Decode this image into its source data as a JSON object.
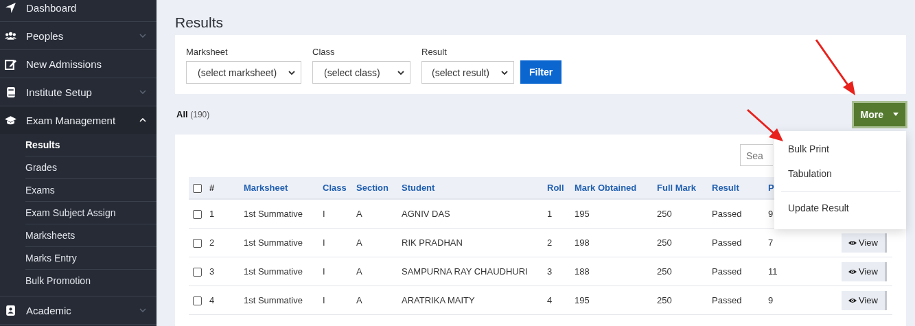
{
  "sidebar": {
    "items": [
      {
        "label": "Dashboard",
        "expandable": false
      },
      {
        "label": "Peoples",
        "expandable": true,
        "expanded": false
      },
      {
        "label": "New Admissions",
        "expandable": false
      },
      {
        "label": "Institute Setup",
        "expandable": true,
        "expanded": false
      },
      {
        "label": "Exam Management",
        "expandable": true,
        "expanded": true,
        "children": [
          {
            "label": "Results",
            "selected": true
          },
          {
            "label": "Grades",
            "selected": false
          },
          {
            "label": "Exams",
            "selected": false
          },
          {
            "label": "Exam Subject Assign",
            "selected": false
          },
          {
            "label": "Marksheets",
            "selected": false
          },
          {
            "label": "Marks Entry",
            "selected": false
          },
          {
            "label": "Bulk Promotion",
            "selected": false
          }
        ]
      },
      {
        "label": "Academic",
        "expandable": true,
        "expanded": false
      }
    ]
  },
  "page_title": "Results",
  "filters": [
    {
      "label": "Marksheet",
      "value": "(select marksheet)"
    },
    {
      "label": "Class",
      "value": "(select class)"
    },
    {
      "label": "Result",
      "value": "(select result)"
    }
  ],
  "filter_button": "Filter",
  "tab": {
    "label": "All",
    "count": "(190)"
  },
  "more_button": {
    "label": "More",
    "open": true,
    "menu": [
      [
        "Bulk Print",
        "Tabulation"
      ],
      [
        "Update Result"
      ]
    ]
  },
  "search": {
    "placeholder": "Sea"
  },
  "table": {
    "header_checked": false,
    "columns": [
      "#",
      "Marksheet",
      "Class",
      "Section",
      "Student",
      "Roll",
      "Mark Obtained",
      "Full Mark",
      "Result",
      "P"
    ],
    "rows": [
      {
        "checked": false,
        "cells": [
          "1",
          "1st Summative",
          "I",
          "A",
          "AGNIV DAS",
          "1",
          "195",
          "250",
          "Passed",
          "9"
        ]
      },
      {
        "checked": false,
        "cells": [
          "2",
          "1st Summative",
          "I",
          "A",
          "RIK PRADHAN",
          "2",
          "198",
          "250",
          "Passed",
          "7"
        ],
        "action": "View"
      },
      {
        "checked": false,
        "cells": [
          "3",
          "1st Summative",
          "I",
          "A",
          "SAMPURNA RAY CHAUDHURI",
          "3",
          "188",
          "250",
          "Passed",
          "11"
        ],
        "action": "View"
      },
      {
        "checked": false,
        "cells": [
          "4",
          "1st Summative",
          "I",
          "A",
          "ARATRIKA MAITY",
          "4",
          "195",
          "250",
          "Passed",
          "9"
        ],
        "action": "View"
      }
    ]
  }
}
